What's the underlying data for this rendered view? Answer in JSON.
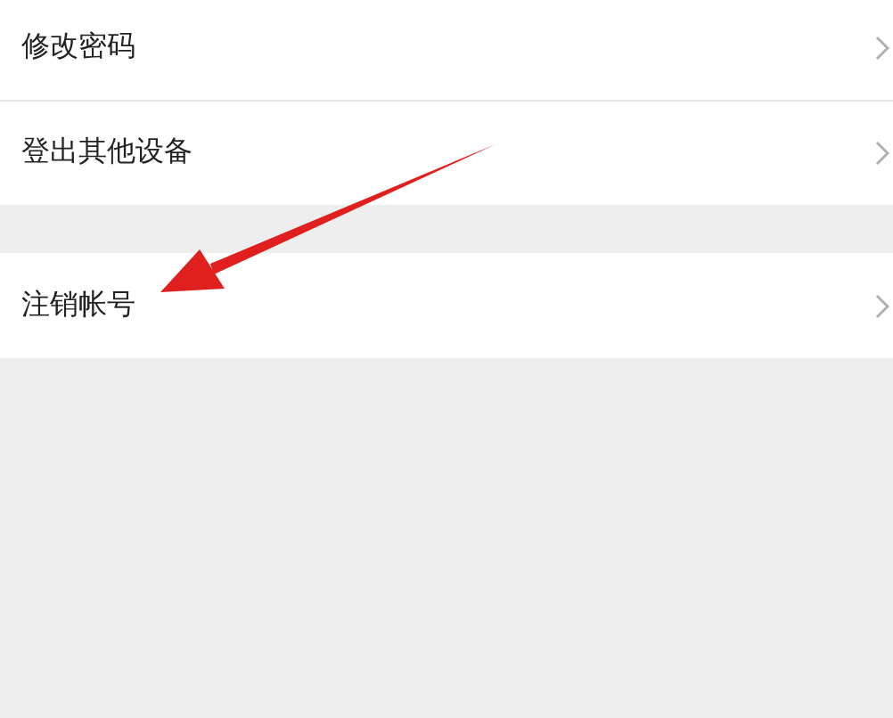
{
  "sections": [
    {
      "items": [
        {
          "label": "修改密码"
        },
        {
          "label": "登出其他设备"
        }
      ]
    },
    {
      "items": [
        {
          "label": "注销帐号"
        }
      ]
    }
  ]
}
